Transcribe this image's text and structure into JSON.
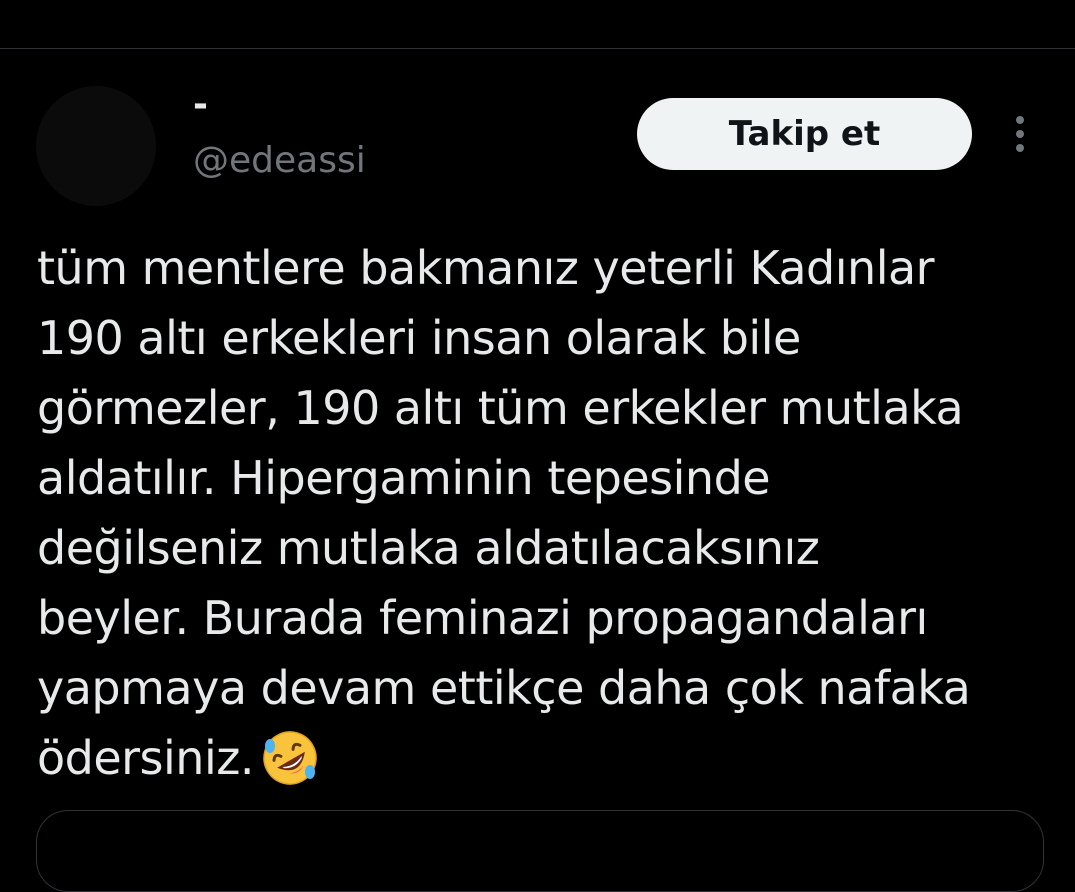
{
  "author": {
    "display_name": "-",
    "handle": "@edeassi"
  },
  "actions": {
    "follow_label": "Takip et",
    "more_icon": "more-vertical-icon"
  },
  "tweet": {
    "lines": [
      "tüm mentlere bakmanız yeterli Kadınlar",
      "190 altı erkekleri insan olarak bile",
      "görmezler, 190 altı tüm erkekler mutlaka",
      "aldatılır. Hipergaminin tepesinde",
      "değilseniz mutlaka aldatılacaksınız",
      "beyler. Burada feminazi propagandaları",
      "yapmaya devam ettikçe daha çok nafaka",
      "ödersiniz."
    ],
    "emoji": "rolling-on-the-floor-laughing-icon"
  },
  "colors": {
    "background": "#000000",
    "text_primary": "#e7e9ea",
    "text_secondary": "#71767b",
    "button_bg": "#eff3f4",
    "button_text": "#0f1419",
    "divider": "#2f3336"
  }
}
